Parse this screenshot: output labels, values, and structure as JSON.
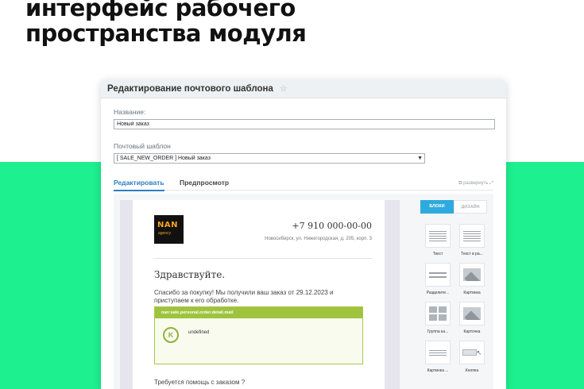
{
  "headline": {
    "line1": "интерфейс рабочего",
    "line2": "пространства модуля"
  },
  "window": {
    "title": "Редактирование почтового шаблона",
    "star_icon": "star-icon"
  },
  "form": {
    "name_label": "Название:",
    "name_value": "Новый заказ",
    "template_label": "Почтовый шаблон",
    "template_value": "[ SALE_NEW_ORDER ] Новый заказ"
  },
  "tabs": {
    "edit": "Редактировать",
    "preview": "Предпросмотр",
    "expand": "развернуть"
  },
  "mail": {
    "logo_top": "NAN",
    "logo_bottom": "agency",
    "phone": "+7 910 000-00-00",
    "address": "Новосибирск, ул. Нижегородская, д. 205, корп. 3",
    "greeting": "Здравствуйте.",
    "thanks": "Спасибо за покупку! Мы получили ваш заказ от 29.12.2023 и приступаем к его обработке.",
    "order_header": "nan:sale.personal.order.detail.mail",
    "order_icon": "K",
    "order_text": "undefined",
    "help": "Требуется помощь с заказом ?"
  },
  "panel": {
    "tab_blocks": "БЛОКИ",
    "tab_design": "ДИЗАЙН",
    "blocks": [
      {
        "label": "Текст",
        "icon": "text-block-icon"
      },
      {
        "label": "Текст в ра...",
        "icon": "framed-text-block-icon"
      },
      {
        "label": "Разделите...",
        "icon": "divider-block-icon"
      },
      {
        "label": "Картинка",
        "icon": "image-block-icon"
      },
      {
        "label": "Группа ка...",
        "icon": "image-group-block-icon"
      },
      {
        "label": "Карточка",
        "icon": "card-block-icon"
      },
      {
        "label": "Картинка ...",
        "icon": "image-text-block-icon"
      },
      {
        "label": "Кнопка",
        "icon": "button-block-icon"
      }
    ]
  },
  "colors": {
    "accent_green": "#1df08f",
    "tab_blue": "#2d7ec1",
    "blocks_tab": "#2faadf",
    "order_green": "#9ec33d"
  }
}
